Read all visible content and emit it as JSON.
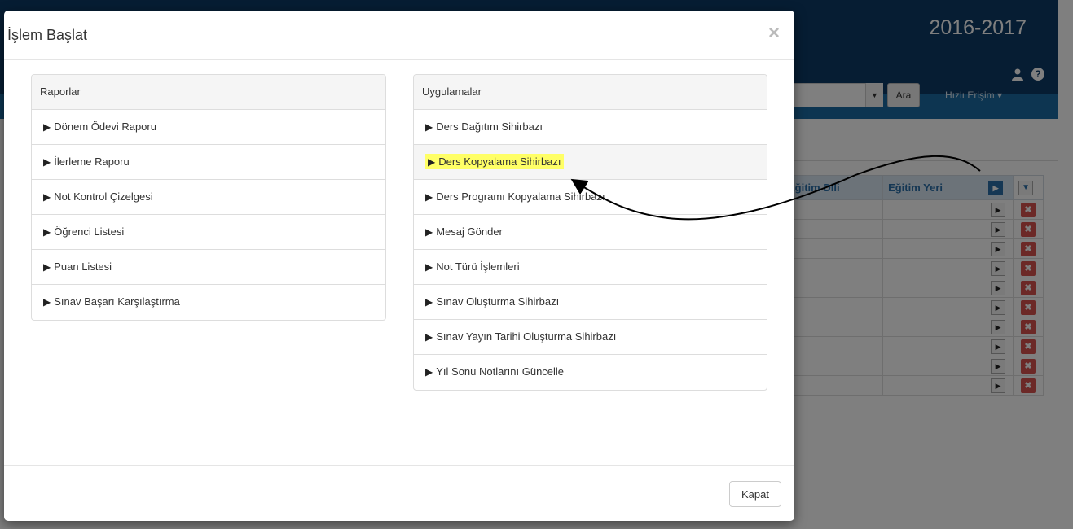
{
  "header": {
    "year": "2016-2017",
    "search_button": "Ara",
    "quick_access": "Hızlı Erişim ▾"
  },
  "table": {
    "columns": [
      "Eğitim Dili",
      "Eğitim Yeri"
    ]
  },
  "modal": {
    "title": "İşlem Başlat",
    "close_glyph": "×",
    "reports": {
      "heading": "Raporlar",
      "items": [
        "Dönem Ödevi Raporu",
        "İlerleme Raporu",
        "Not Kontrol Çizelgesi",
        "Öğrenci Listesi",
        "Puan Listesi",
        "Sınav Başarı Karşılaştırma"
      ]
    },
    "applications": {
      "heading": "Uygulamalar",
      "items": [
        "Ders Dağıtım Sihirbazı",
        "Ders Kopyalama Sihirbazı",
        "Ders Programı Kopyalama Sihirbazı",
        "Mesaj Gönder",
        "Not Türü İşlemleri",
        "Sınav Oluşturma Sihirbazı",
        "Sınav Yayın Tarihi Oluşturma Sihirbazı",
        "Yıl Sonu Notlarını Güncelle"
      ],
      "highlighted_item": "Ders Kopyalama Sihirbazı"
    },
    "footer": {
      "close_button": "Kapat"
    }
  },
  "colors": {
    "topbar": "#0d3a66",
    "navbar": "#1a6aa2",
    "highlight": "#ffff66",
    "delete": "#d9534f"
  }
}
